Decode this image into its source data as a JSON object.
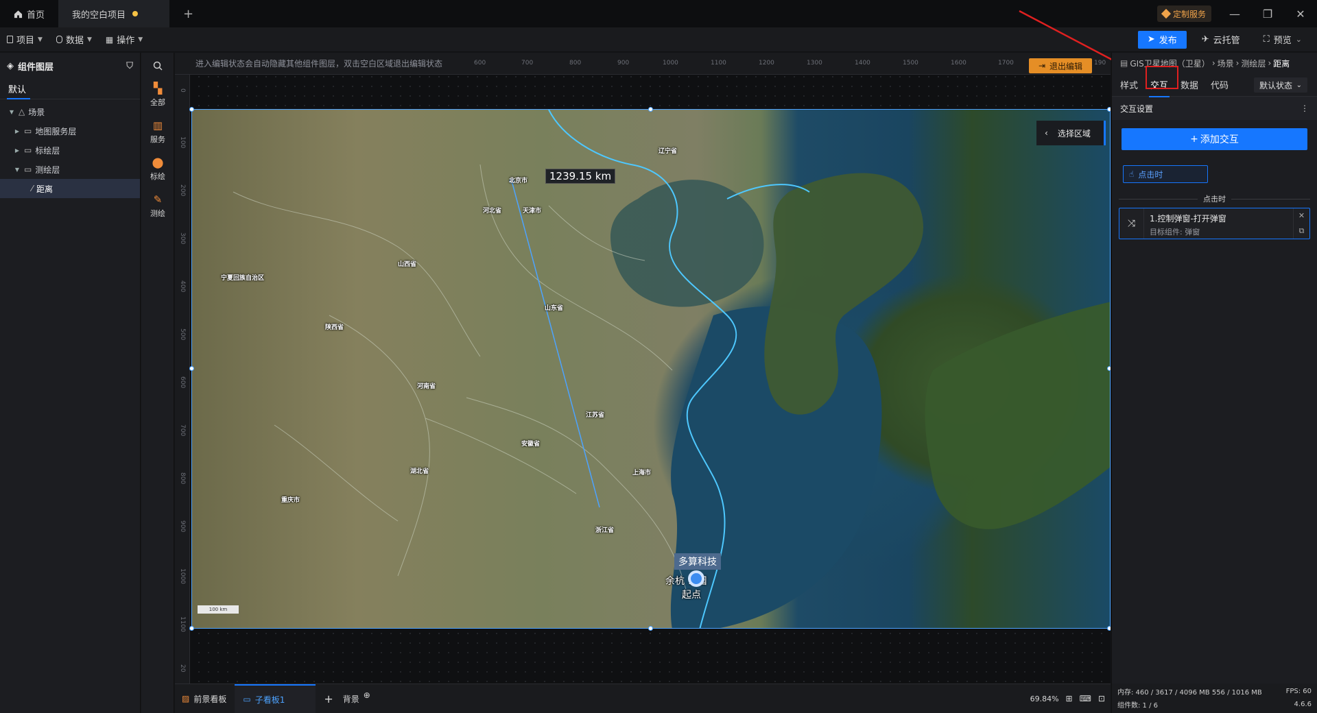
{
  "titlebar": {
    "home_tab": "首页",
    "project_tab": "我的空白项目",
    "custom_service": "定制服务",
    "colors": {
      "accent": "#1677ff",
      "unsaved": "#f6c244",
      "service": "#f0a34a"
    }
  },
  "toolbar": {
    "menus": [
      {
        "label": "项目",
        "icon": "file-icon"
      },
      {
        "label": "数据",
        "icon": "database-icon"
      },
      {
        "label": "操作",
        "icon": "grid-icon"
      }
    ],
    "publish": "发布",
    "cloud": "云托管",
    "preview": "预览"
  },
  "layers": {
    "title": "组件图层",
    "tab": "默认",
    "tree": [
      {
        "label": "场景",
        "level": 0,
        "expanded": true
      },
      {
        "label": "地图服务层",
        "level": 1,
        "expanded": false
      },
      {
        "label": "标绘层",
        "level": 1,
        "expanded": false
      },
      {
        "label": "测绘层",
        "level": 1,
        "expanded": true
      },
      {
        "label": "距离",
        "level": 2,
        "selected": true
      }
    ]
  },
  "rail": [
    {
      "label": "全部",
      "icon": "grid-icon",
      "color": "#f08c3a"
    },
    {
      "label": "服务",
      "icon": "map-icon",
      "color": "#f08c3a"
    },
    {
      "label": "标绘",
      "icon": "pin-icon",
      "color": "#f08c3a"
    },
    {
      "label": "测绘",
      "icon": "ruler-icon",
      "color": "#f08c3a"
    }
  ],
  "canvas": {
    "hint": "进入编辑状态会自动隐藏其他组件图层，双击空白区域退出编辑状态",
    "exit_edit": "退出编辑",
    "ruler_top": [
      "600",
      "700",
      "800",
      "900",
      "1000",
      "1100",
      "1200",
      "1300",
      "1400",
      "1500",
      "1600",
      "1700",
      "190"
    ],
    "ruler_left": [
      "0",
      "100",
      "200",
      "300",
      "400",
      "500",
      "600",
      "700",
      "800",
      "900",
      "1000",
      "1100",
      "20"
    ],
    "map": {
      "distance": "1239.15 km",
      "select_area": "选择区域",
      "poi_tag": "多算科技",
      "poi_name": "余杭  公园",
      "start": "起点",
      "scale": "100 km",
      "provinces": [
        "辽宁省",
        "北京市",
        "河北省",
        "天津市",
        "山西省",
        "宁夏回族自治区",
        "陕西省",
        "山东省",
        "河南省",
        "江苏省",
        "安徽省",
        "湖北省",
        "上海市",
        "重庆市",
        "浙江省"
      ]
    }
  },
  "rightpanel": {
    "breadcrumb": [
      "GIS卫星地图（卫星）",
      "场景",
      "测绘层",
      "距离"
    ],
    "tabs": [
      "样式",
      "交互",
      "数据",
      "代码"
    ],
    "state": "默认状态",
    "section": "交互设置",
    "add": "添加交互",
    "event": "点击时",
    "divider": "点击时",
    "action_title": "1.控制弹窗-打开弹窗",
    "action_sub": "目标组件: 弹窗"
  },
  "bottombar": {
    "tabs": [
      "前景看板",
      "子看板1"
    ],
    "background": "背景",
    "zoom": "69.84%"
  },
  "status": {
    "memory": "内存: 460 / 3617 / 4096 MB  556 / 1016 MB",
    "fps": "FPS:  60",
    "components": "组件数: 1 / 6",
    "version": "4.6.6"
  }
}
